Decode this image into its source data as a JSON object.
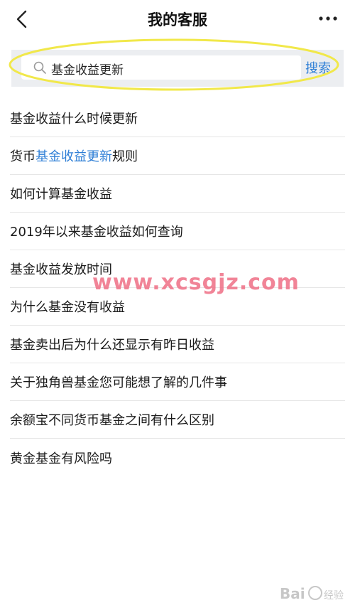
{
  "header": {
    "title": "我的客服",
    "back_icon": "chevron-left-icon",
    "more_icon": "more-horizontal-icon"
  },
  "search": {
    "query": "基金收益更新",
    "button_label": "搜索",
    "icon": "search-icon"
  },
  "results": [
    {
      "parts": [
        "基金收益什么时候更新"
      ]
    },
    {
      "parts": [
        "货币",
        "基金收益更新",
        "规则"
      ]
    },
    {
      "parts": [
        "如何计算基金收益"
      ]
    },
    {
      "parts": [
        "2019年以来基金收益如何查询"
      ]
    },
    {
      "parts": [
        "基金收益发放时间"
      ]
    },
    {
      "parts": [
        "为什么基金没有收益"
      ]
    },
    {
      "parts": [
        "基金卖出后为什么还显示有昨日收益"
      ]
    },
    {
      "parts": [
        "关于独角兽基金您可能想了解的几件事"
      ]
    },
    {
      "parts": [
        "余额宝不同货币基金之间有什么区别"
      ]
    },
    {
      "parts": [
        "黄金基金有风险吗"
      ]
    }
  ],
  "watermark": {
    "site": "www.xcsgjz.com",
    "baidu": "Bai 经验"
  },
  "colors": {
    "accent": "#2f7fd6",
    "highlight_ring": "#f1e84a",
    "watermark": "#ef6f86"
  }
}
